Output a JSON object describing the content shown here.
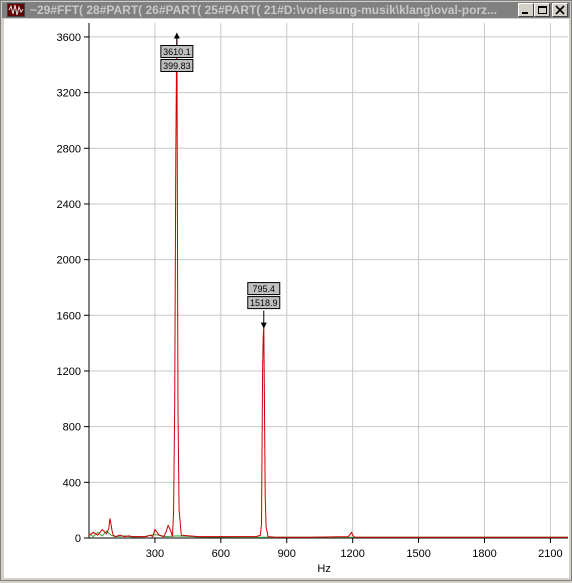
{
  "window": {
    "title": "~29#FFT( 28#PART( 26#PART( 25#PART( 21#D:\\vorlesung-musik\\klang\\oval-porz..."
  },
  "icons": {
    "app": "waveform-app-icon",
    "minimize": "minimize-icon",
    "maximize": "maximize-icon",
    "close": "close-icon"
  },
  "colors": {
    "spectrum": "#cc0000",
    "secondary_trace": "#40a040",
    "grid": "#c8c8c8",
    "marker_box": "#c0c0c0"
  },
  "chart_data": {
    "type": "line",
    "title": "",
    "xlabel": "Hz",
    "ylabel": "",
    "xlim": [
      0,
      2180
    ],
    "ylim": [
      0,
      3700
    ],
    "x_ticks": [
      300,
      600,
      900,
      1200,
      1500,
      1800,
      2100
    ],
    "x_tick_labels": [
      "300",
      "600",
      "900",
      "1200",
      "1500",
      "1800",
      "2100"
    ],
    "y_ticks": [
      0,
      400,
      800,
      1200,
      1600,
      2000,
      2400,
      2800,
      3200,
      3600
    ],
    "y_tick_labels": [
      "0",
      "400",
      "800",
      "1200",
      "1600",
      "2000",
      "2400",
      "2800",
      "3200",
      "3600"
    ],
    "grid": true,
    "series": [
      {
        "color": "#cc0000",
        "x": [
          0,
          20,
          40,
          60,
          80,
          90,
          95,
          100,
          105,
          110,
          120,
          140,
          160,
          180,
          200,
          260,
          280,
          290,
          300,
          320,
          340,
          350,
          360,
          370,
          380,
          385,
          390,
          395,
          398,
          399.83,
          402,
          405,
          410,
          420,
          500,
          600,
          700,
          760,
          780,
          785,
          790,
          793,
          795.4,
          798,
          802,
          806,
          815,
          850,
          1000,
          1180,
          1195,
          1200,
          1210,
          1250,
          1400,
          1600,
          1800,
          2000,
          2180
        ],
        "y": [
          20,
          40,
          20,
          60,
          30,
          70,
          140,
          100,
          50,
          20,
          10,
          20,
          10,
          15,
          10,
          10,
          20,
          10,
          60,
          20,
          10,
          40,
          90,
          60,
          10,
          200,
          950,
          2750,
          3400,
          3610,
          2600,
          900,
          200,
          20,
          10,
          10,
          10,
          10,
          20,
          100,
          1200,
          1450,
          1519,
          1100,
          300,
          80,
          10,
          5,
          5,
          10,
          40,
          20,
          5,
          5,
          5,
          5,
          5,
          5,
          5
        ]
      },
      {
        "color": "#40a040",
        "x": [
          0,
          20,
          40,
          60,
          80,
          100,
          120,
          160,
          200,
          250,
          300,
          350,
          400,
          500,
          700,
          900,
          1200,
          1600,
          2180
        ],
        "y": [
          30,
          10,
          40,
          15,
          50,
          20,
          10,
          15,
          8,
          10,
          25,
          10,
          15,
          8,
          6,
          5,
          5,
          5,
          5
        ]
      }
    ],
    "annotations": [
      {
        "x": 399.83,
        "y": 3610.1,
        "label_top": "3610.1",
        "label_bottom": "399.83"
      },
      {
        "x": 795.4,
        "y": 1518.9,
        "label_top": "795.4",
        "label_bottom": "1518.9"
      }
    ]
  }
}
